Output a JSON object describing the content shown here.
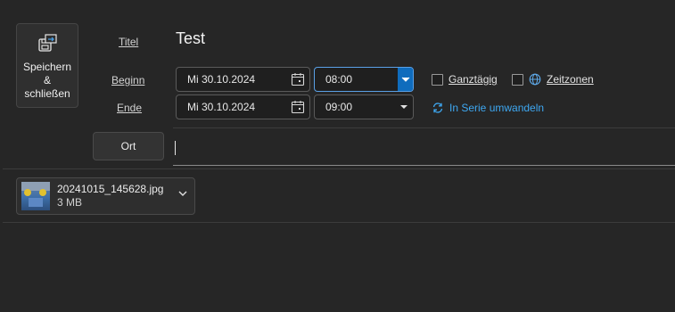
{
  "save_button": {
    "label": "Speichern\n&\nschließen",
    "icon": "save-close-icon"
  },
  "form": {
    "title_label": "Titel",
    "title_value": "Test",
    "start_label": "Beginn",
    "end_label": "Ende",
    "start_date": "Mi 30.10.2024",
    "start_time": "08:00",
    "end_date": "Mi 30.10.2024",
    "end_time": "09:00",
    "all_day_label": "Ganztägig",
    "timezones_label": "Zeitzonen",
    "series_label": "In Serie umwandeln",
    "location_button": "Ort",
    "location_value": ""
  },
  "attachment": {
    "file_name": "20241015_145628.jpg",
    "file_size": "3 MB"
  },
  "colors": {
    "background": "#262626",
    "accent": "#0f6cbd",
    "link": "#3ea8f2"
  }
}
